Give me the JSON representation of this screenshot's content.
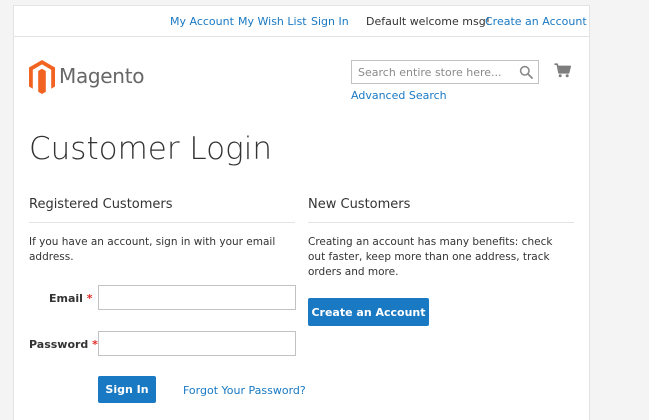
{
  "header": {
    "links": {
      "my_account": "My Account",
      "wish_list": "My Wish List",
      "sign_in": "Sign In",
      "create_account": "Create an Account"
    },
    "welcome": "Default welcome msg!"
  },
  "brand": {
    "name": "Magento",
    "logo_color": "#f26322"
  },
  "search": {
    "placeholder": "Search entire store here...",
    "advanced_label": "Advanced Search"
  },
  "page": {
    "title": "Customer Login"
  },
  "registered": {
    "title": "Registered Customers",
    "note": "If you have an account, sign in with your email address.",
    "email_label": "Email",
    "password_label": "Password",
    "required_mark": "*",
    "sign_in_button": "Sign In",
    "forgot_link": "Forgot Your Password?"
  },
  "new_customers": {
    "title": "New Customers",
    "note": "Creating an account has many benefits: check out faster, keep more than one address, track orders and more.",
    "create_button": "Create an Account"
  },
  "colors": {
    "link": "#1979c3",
    "button": "#1979c3",
    "required": "#e02b27",
    "logo": "#f26322"
  },
  "icons": [
    "search-icon",
    "cart-icon",
    "magento-logo-icon"
  ]
}
